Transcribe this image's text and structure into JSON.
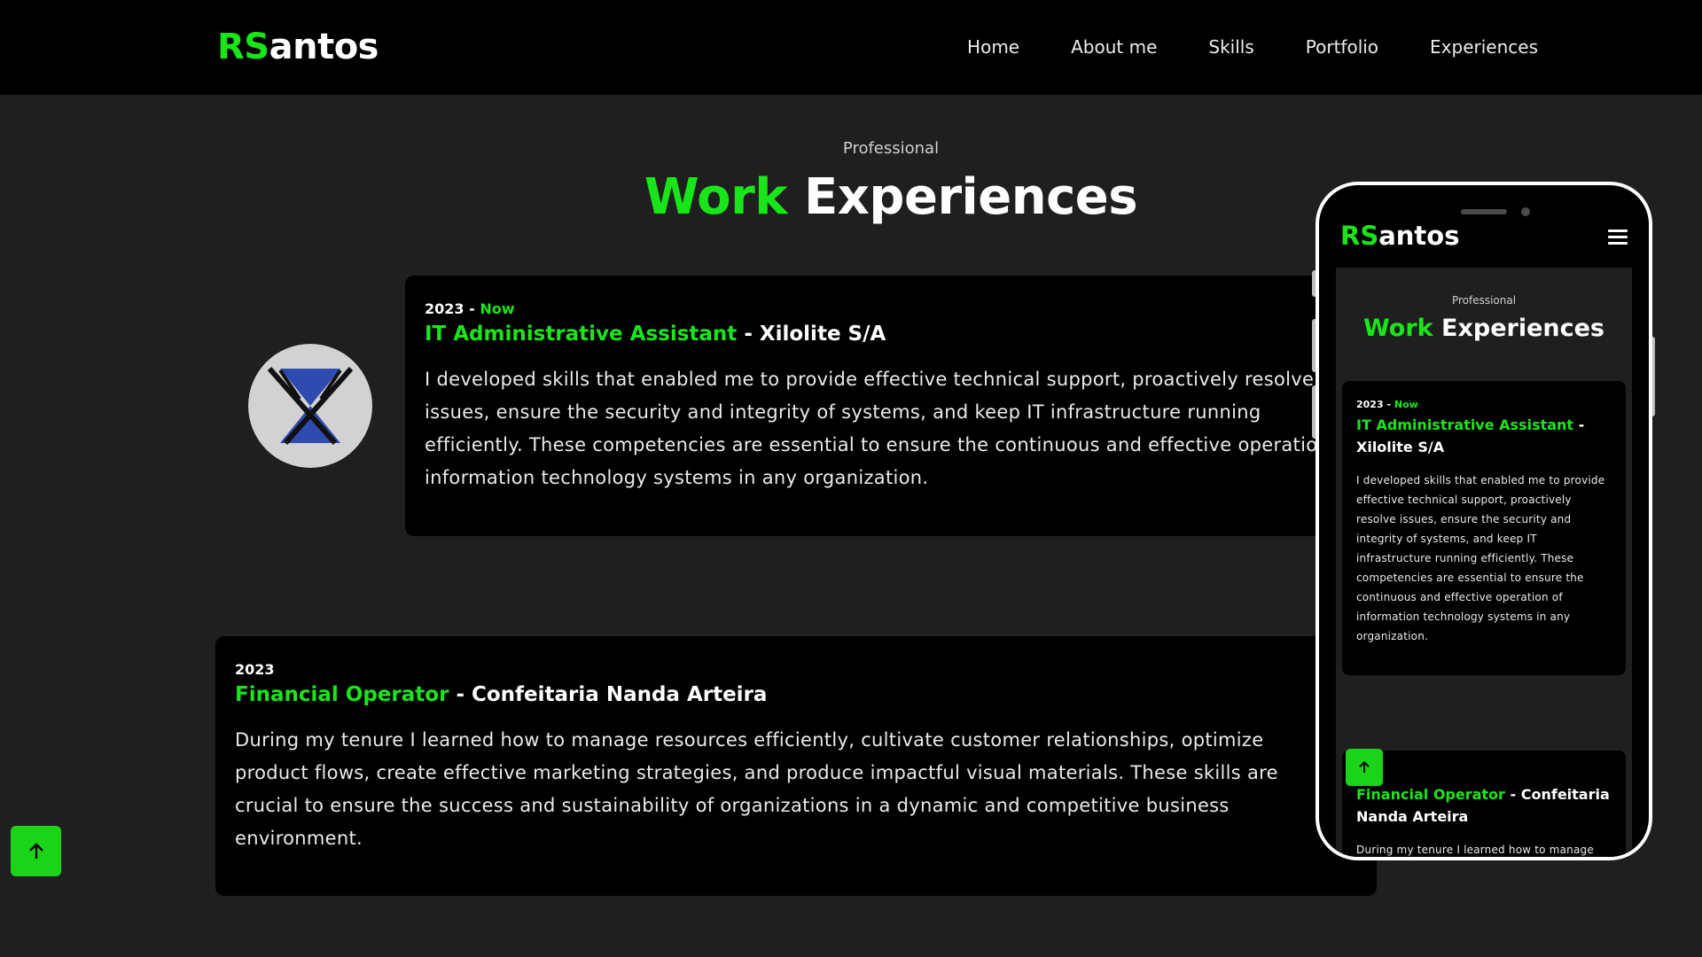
{
  "brand": {
    "accent": "RS",
    "rest": "antos",
    "accent_color": "#19e619"
  },
  "nav": {
    "items": [
      {
        "label": "Home"
      },
      {
        "label": "About me"
      },
      {
        "label": "Skills"
      },
      {
        "label": "Portfolio"
      },
      {
        "label": "Experiences"
      }
    ]
  },
  "section": {
    "eyebrow": "Professional",
    "title_accent": "Work",
    "title_rest": "Experiences"
  },
  "experiences": [
    {
      "year": "2023",
      "separator": "-",
      "status": "Now",
      "role": "IT Administrative Assistant",
      "company_sep": "-",
      "company": "Xilolite S/A",
      "description": "I developed skills that enabled me to provide effective technical support, proactively resolve issues, ensure the security and integrity of systems, and keep IT infrastructure running efficiently. These competencies are essential to ensure the continuous and effective operation of information technology systems in any organization."
    },
    {
      "year": "2023",
      "role": "Financial Operator",
      "company_sep": "-",
      "company": "Confeitaria Nanda Arteira",
      "description": "During my tenure I learned how to manage resources efficiently, cultivate customer relationships, optimize product flows, create effective marketing strategies, and produce impactful visual materials. These skills are crucial to ensure the success and sustainability of organizations in a dynamic and competitive business environment."
    }
  ],
  "icons": {
    "scroll_top": "arrow-up-icon",
    "menu": "hamburger-menu-icon",
    "company_logo": "xilolite-logo-icon"
  },
  "colors": {
    "background": "#1f1f1f",
    "header": "#000000",
    "card": "#000000",
    "accent": "#19e619",
    "scroll_button": "#19d419"
  }
}
